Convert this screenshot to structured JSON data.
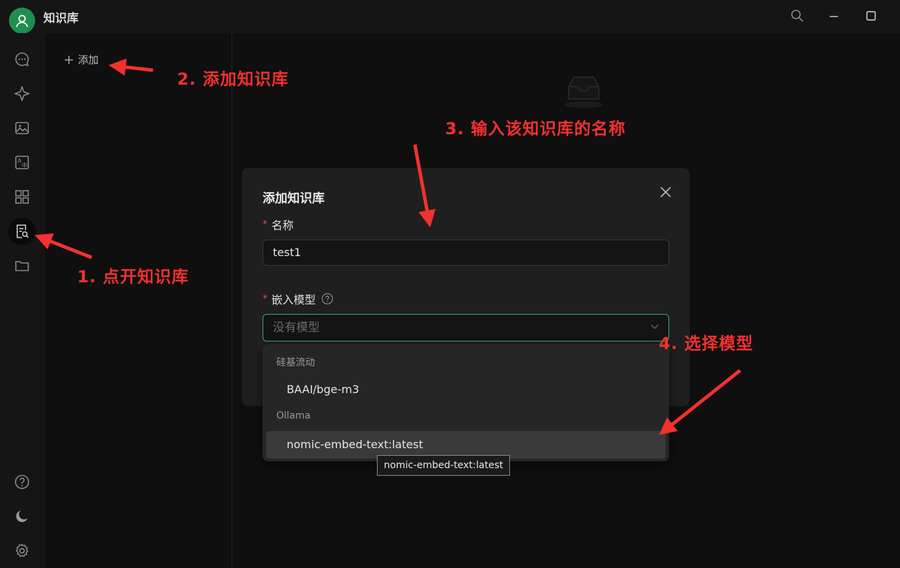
{
  "app": {
    "title": "知识库"
  },
  "kb_list": {
    "add_label": "添加"
  },
  "modal": {
    "title": "添加知识库",
    "name_label": "名称",
    "name_value": "test1",
    "embed_label": "嵌入模型",
    "embed_placeholder": "没有模型"
  },
  "dropdown": {
    "groups": [
      {
        "label": "硅基流动",
        "options": [
          "BAAI/bge-m3"
        ]
      },
      {
        "label": "Ollama",
        "options": [
          "nomic-embed-text:latest"
        ]
      }
    ],
    "hovered_option": "nomic-embed-text:latest",
    "tooltip": "nomic-embed-text:latest"
  },
  "annotations": {
    "step1": "1. 点开知识库",
    "step2": "2. 添加知识库",
    "step3": "3. 输入该知识库的名称",
    "step4": "4. 选择模型"
  },
  "colors": {
    "accent_green": "#2fb37a",
    "avatar_green": "#1f8f4e",
    "annotation_red": "#f3312f",
    "required_red": "#e5484d"
  },
  "icons": {
    "rail": [
      "chat-icon",
      "sparkle-icon",
      "image-icon",
      "translate-icon",
      "apps-icon",
      "knowledge-icon",
      "folder-icon",
      "help-icon",
      "moon-icon",
      "gear-icon"
    ]
  }
}
